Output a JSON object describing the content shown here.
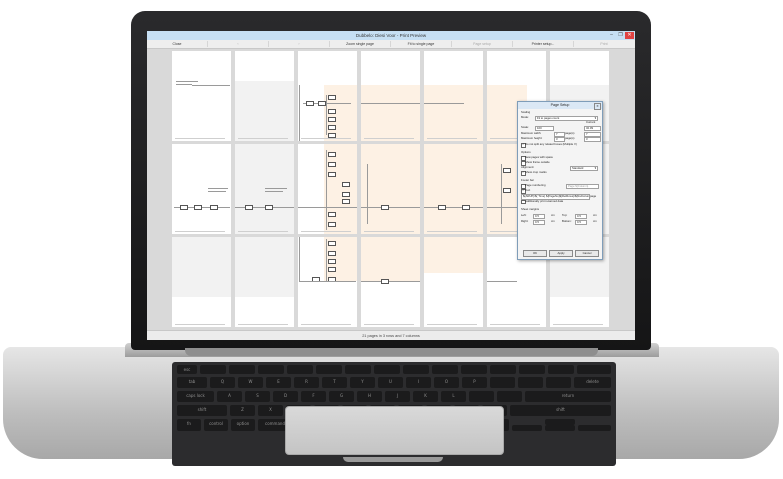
{
  "window": {
    "title": "Dubbelo: Diesi Voor - Print Preview",
    "min_glyph": "–",
    "max_glyph": "❐",
    "close_glyph": "✕"
  },
  "toolbar": {
    "buttons": [
      {
        "label": "Close",
        "enabled": true
      },
      {
        "label": "‹",
        "enabled": false
      },
      {
        "label": "›",
        "enabled": false
      },
      {
        "label": "Zoom single page",
        "enabled": true
      },
      {
        "label": "Fit to single page",
        "enabled": true
      },
      {
        "label": "Page setup",
        "enabled": false
      },
      {
        "label": "Printer setup...",
        "enabled": true
      },
      {
        "label": "Print",
        "enabled": false
      }
    ]
  },
  "status": {
    "text": "21 pages in 3 rows and 7 columns"
  },
  "dialog": {
    "title": "Page Setup",
    "scaling_heading": "Scaling",
    "mode_label": "Mode:",
    "mode_value": "Fit to pages count",
    "current_label": "Current",
    "scale_label": "Scale:",
    "scale_value": "100",
    "scale_current": "32.09",
    "max_width_label": "Maximum width:",
    "max_width_value": "7",
    "max_width_unit": "page(s)",
    "max_width_current": "7",
    "max_height_label": "Maximum height:",
    "max_height_value": "3",
    "max_height_unit": "page(s)",
    "max_height_current": "3",
    "no_split_label": "Do not split any related boxes (Multiple V)",
    "options_heading": "Options",
    "opt_new_page": "New pages with space",
    "opt_show_frame": "Show frame outside",
    "alignment_label": "Alignment:",
    "alignment_value": "Standard",
    "opt_crop_marks": "Show crop marks",
    "footer_heading": "Footer bar",
    "page_numbering_label": "Page numbering",
    "page_numbering_value": "Page ${Column}",
    "text_label": "Text",
    "text_value": "${ARUP}/${ Time} ${PageNo}${RelRows}/${RelColumns}",
    "text_extra": "page",
    "additionally_label": "Additionally print scanned data",
    "margins_heading": "Sheet margins",
    "left_label": "Left:",
    "left_value": "0.5",
    "top_label": "Top:",
    "top_value": "0.5",
    "right_label": "Right:",
    "right_value": "0.5",
    "bottom_label": "Bottom:",
    "bottom_value": "0.5",
    "unit": "cm",
    "ok_label": "OK",
    "apply_label": "Apply",
    "cancel_label": "Cancel",
    "close_glyph": "✕"
  },
  "keyboard": {
    "labels": [
      "esc",
      "tab",
      "caps lock",
      "shift",
      "fn",
      "control",
      "option",
      "command",
      "Q",
      "W",
      "E",
      "R",
      "T",
      "Y",
      "U",
      "I",
      "O",
      "P",
      "A",
      "S",
      "D",
      "F",
      "G",
      "H",
      "J",
      "K",
      "L",
      "Z",
      "X",
      "C",
      "V",
      "B",
      "N",
      "M",
      "delete",
      "return",
      "shift"
    ]
  }
}
